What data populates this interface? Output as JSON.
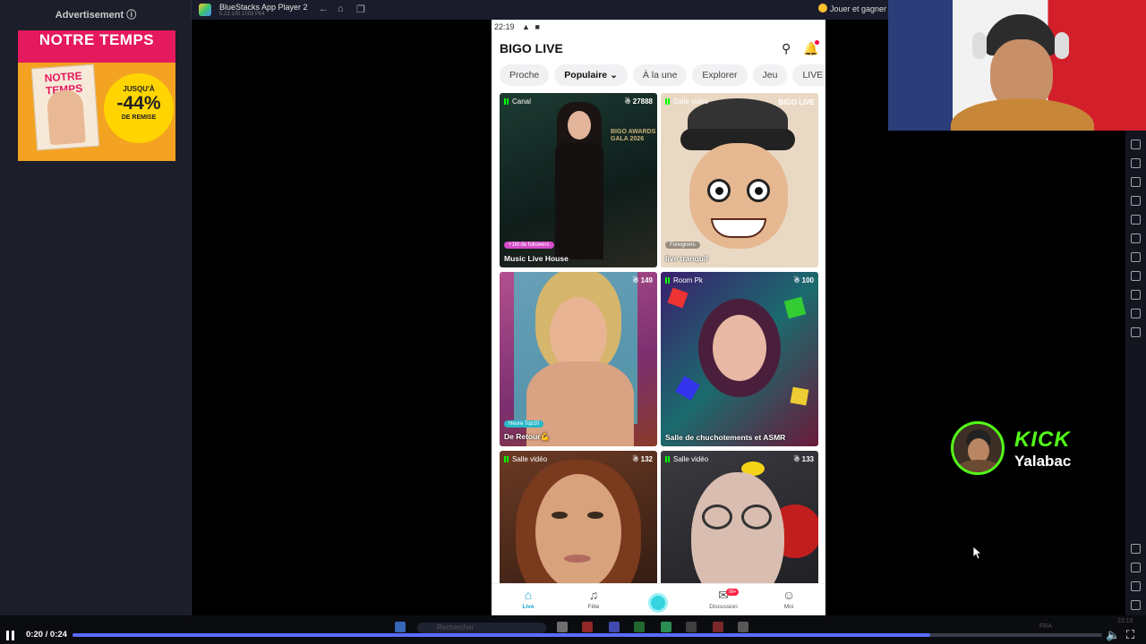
{
  "ad": {
    "label": "Advertisement",
    "info_icon": "info-icon",
    "brand": "NOTRE TEMPS",
    "mag_title": "NOTRE TEMPS",
    "promo_top": "JUSQU'À",
    "promo_value": "-44%",
    "promo_bottom": "DE REMISE"
  },
  "bluestacks": {
    "title": "BlueStacks App Player 2",
    "version": "5.22.100.1003  P64",
    "play_label": "Jouer et gagner"
  },
  "phone": {
    "time": "22:19",
    "app_title": "BIGO LIVE",
    "tabs": [
      "Proche",
      "Populaire",
      "À la une",
      "Explorer",
      "Jeu",
      "LIVE Virtuel"
    ],
    "active_tab": "Populaire",
    "cards": [
      {
        "tag": "Canal",
        "count": "27888",
        "badge": "+1M de followers",
        "label": "Music Live House",
        "overlay": "BIGO AWARDS GALA 2026"
      },
      {
        "tag": "Salle vidéo",
        "count": "",
        "badge": "Foreigners",
        "label": "live tranquil",
        "overlay": "BIGO LIVE"
      },
      {
        "tag": "",
        "count": "149",
        "badge": "Heure Top10",
        "label": "De Retour💪"
      },
      {
        "tag": "Room Pk",
        "count": "100",
        "badge": "",
        "label": "Salle de chuchotements et ASMR"
      },
      {
        "tag": "Salle vidéo",
        "count": "132",
        "badge": "",
        "label": ""
      },
      {
        "tag": "Salle vidéo",
        "count": "133",
        "badge": "",
        "label": ""
      }
    ],
    "nav": {
      "live": "Live",
      "fete": "Fête",
      "discussion": "Discussion",
      "discussion_badge": "99+",
      "moi": "Moi"
    }
  },
  "kick": {
    "brand": "KICK",
    "username": "Yalabac"
  },
  "player": {
    "time": "0:20 / 0:24",
    "progress": 0.833
  },
  "taskbar": {
    "search_placeholder": "Rechercher",
    "lang": "FRA",
    "clock": "22:19"
  },
  "colors": {
    "accent_kick": "#53fc18",
    "progress": "#5b6cff",
    "bigo_active": "#18a6d6"
  }
}
